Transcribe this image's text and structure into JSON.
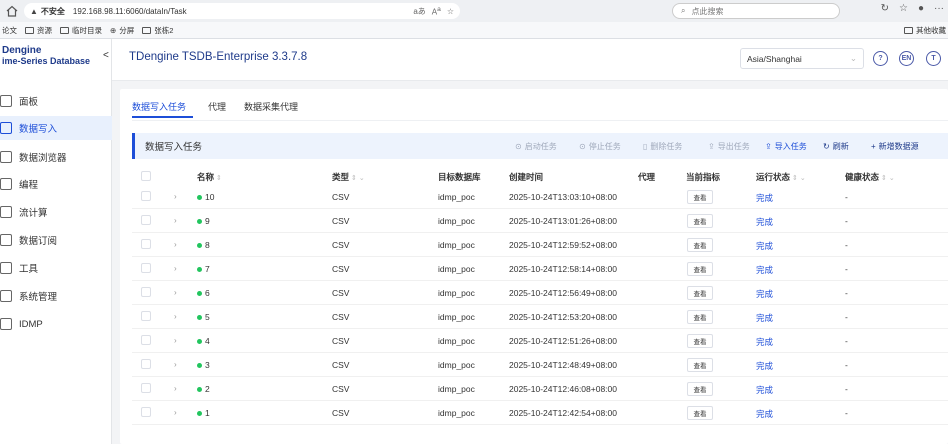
{
  "browser": {
    "insecure_label": "不安全",
    "url": "192.168.98.11:6060/dataIn/Task",
    "search_placeholder": "点此搜索"
  },
  "bookmarks": {
    "items": [
      "论文",
      "资源",
      "临时目录",
      "分屏",
      "张栋2"
    ],
    "other": "其他收藏"
  },
  "logo": {
    "line1": "Dengine",
    "line2": "ime-Series Database"
  },
  "sidebar": {
    "items": [
      {
        "label": "面板"
      },
      {
        "label": "数据写入",
        "active": true
      },
      {
        "label": "数据浏览器"
      },
      {
        "label": "编程"
      },
      {
        "label": "流计算"
      },
      {
        "label": "数据订阅"
      },
      {
        "label": "工具"
      },
      {
        "label": "系统管理"
      },
      {
        "label": "IDMP"
      }
    ]
  },
  "header": {
    "title": "TDengine TSDB-Enterprise 3.3.7.8",
    "timezone": "Asia/Shanghai",
    "lang": "EN",
    "theme": "T",
    "help": "?"
  },
  "tabs": [
    {
      "label": "数据写入任务",
      "active": true
    },
    {
      "label": "代理"
    },
    {
      "label": "数据采集代理"
    }
  ],
  "toolbar": {
    "title": "数据写入任务",
    "start": "启动任务",
    "stop": "停止任务",
    "delete": "删除任务",
    "export": "导出任务",
    "import": "导入任务",
    "refresh": "刷新",
    "add": "新增数据源"
  },
  "table": {
    "columns": [
      "名称",
      "类型",
      "目标数据库",
      "创建时间",
      "代理",
      "当前指标",
      "运行状态",
      "健康状态"
    ],
    "view_label": "查看",
    "rows": [
      {
        "name": "10",
        "type": "CSV",
        "db": "idmp_poc",
        "created": "2025-10-24T13:03:10+08:00",
        "agent": "",
        "status": "完成",
        "health": "-"
      },
      {
        "name": "9",
        "type": "CSV",
        "db": "idmp_poc",
        "created": "2025-10-24T13:01:26+08:00",
        "agent": "",
        "status": "完成",
        "health": "-"
      },
      {
        "name": "8",
        "type": "CSV",
        "db": "idmp_poc",
        "created": "2025-10-24T12:59:52+08:00",
        "agent": "",
        "status": "完成",
        "health": "-"
      },
      {
        "name": "7",
        "type": "CSV",
        "db": "idmp_poc",
        "created": "2025-10-24T12:58:14+08:00",
        "agent": "",
        "status": "完成",
        "health": "-"
      },
      {
        "name": "6",
        "type": "CSV",
        "db": "idmp_poc",
        "created": "2025-10-24T12:56:49+08:00",
        "agent": "",
        "status": "完成",
        "health": "-"
      },
      {
        "name": "5",
        "type": "CSV",
        "db": "idmp_poc",
        "created": "2025-10-24T12:53:20+08:00",
        "agent": "",
        "status": "完成",
        "health": "-"
      },
      {
        "name": "4",
        "type": "CSV",
        "db": "idmp_poc",
        "created": "2025-10-24T12:51:26+08:00",
        "agent": "",
        "status": "完成",
        "health": "-"
      },
      {
        "name": "3",
        "type": "CSV",
        "db": "idmp_poc",
        "created": "2025-10-24T12:48:49+08:00",
        "agent": "",
        "status": "完成",
        "health": "-"
      },
      {
        "name": "2",
        "type": "CSV",
        "db": "idmp_poc",
        "created": "2025-10-24T12:46:08+08:00",
        "agent": "",
        "status": "完成",
        "health": "-"
      },
      {
        "name": "1",
        "type": "CSV",
        "db": "idmp_poc",
        "created": "2025-10-24T12:42:54+08:00",
        "agent": "",
        "status": "完成",
        "health": "-"
      }
    ]
  },
  "colors": {
    "accent": "#1d4ed8",
    "status_dot": "#22c55e",
    "toolbar_bg": "#edf3fd"
  }
}
